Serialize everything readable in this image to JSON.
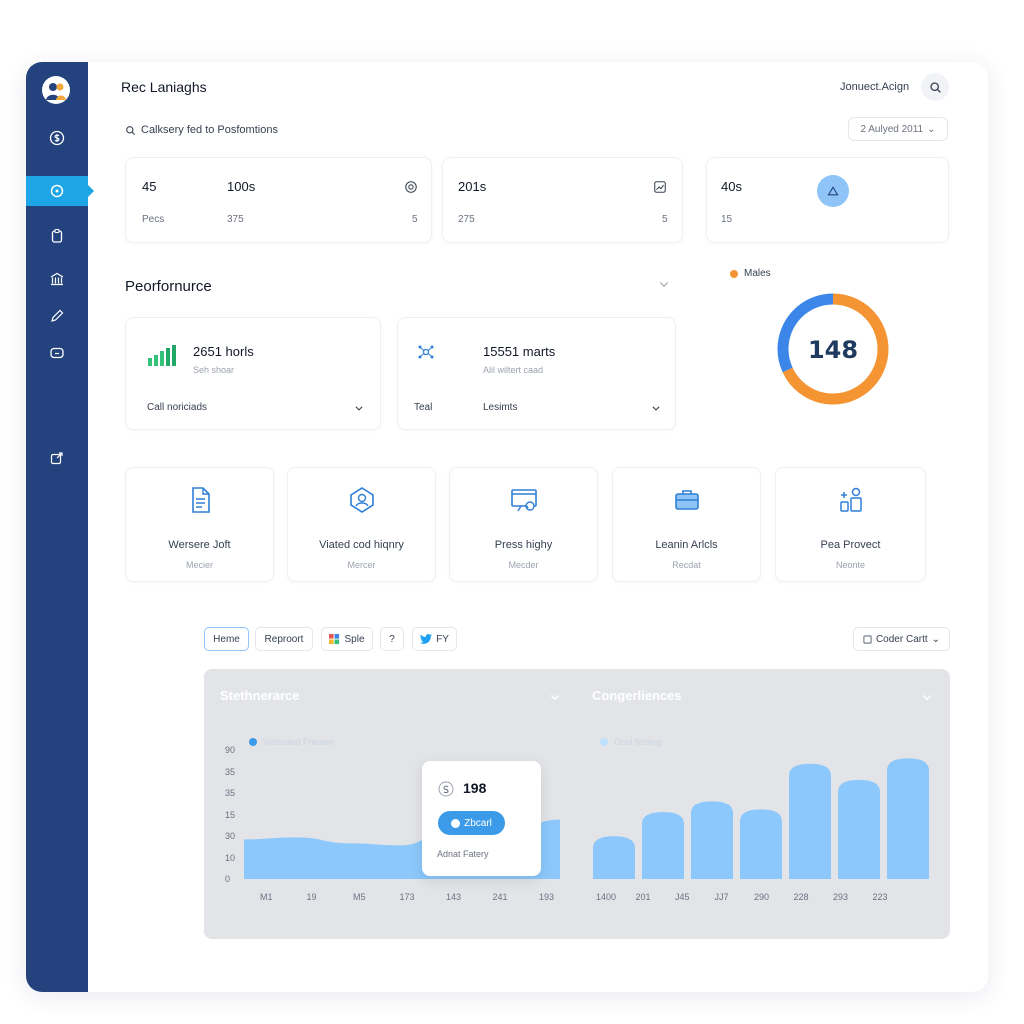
{
  "sidebar": {
    "avatar_icon": "users-icon",
    "items": [
      {
        "icon": "dollar-icon"
      },
      {
        "icon": "dashboard-icon",
        "active": true
      },
      {
        "icon": "clipboard-icon"
      },
      {
        "icon": "bank-icon"
      },
      {
        "icon": "edit-icon"
      },
      {
        "icon": "monitor-icon"
      },
      {
        "icon": "share-icon"
      }
    ]
  },
  "header": {
    "title": "Rec Laniaghs",
    "user_link": "Jonuect.Acign",
    "search_text": "Calksery fed to Posfomtions",
    "date_select": "2 Aulyed 2011"
  },
  "stats": [
    {
      "value_a": "45",
      "value_b": "100s",
      "sub_a": "Pecs",
      "sub_b": "375",
      "sub_c": "5",
      "icon": "badge-icon"
    },
    {
      "value_a": "201s",
      "sub_a": "275",
      "sub_c": "5",
      "icon": "image-icon"
    },
    {
      "value_a": "40s",
      "sub_a": "15",
      "icon": "triangle-icon"
    }
  ],
  "performance": {
    "title": "Peorfornurce",
    "metrics": [
      {
        "value": "2651 horls",
        "sub": "Seh shoar",
        "footer_left": "Call noriciads",
        "footer_right": "",
        "icon": "signal-bars-icon"
      },
      {
        "value": "15551 marts",
        "sub": "Alil wiltert caad",
        "footer_left": "Teal",
        "footer_right": "Lesimts",
        "icon": "network-icon"
      }
    ]
  },
  "donut": {
    "legend": "Males",
    "value": "148",
    "share_blue": 0.32,
    "share_orange": 0.68,
    "colors": {
      "blue": "#3b86e8",
      "orange": "#f59433"
    }
  },
  "tiles": [
    {
      "title": "Wersere Joft",
      "sub": "Mecier",
      "icon": "document-icon"
    },
    {
      "title": "Viated cod hiqnry",
      "sub": "Mercer",
      "icon": "network-icon"
    },
    {
      "title": "Press highy",
      "sub": "Mecder",
      "icon": "presentation-icon"
    },
    {
      "title": "Leanin Arlcls",
      "sub": "Recdat",
      "icon": "briefcase-icon"
    },
    {
      "title": "Pea Provect",
      "sub": "Neonte",
      "icon": "people-icon"
    }
  ],
  "tabs": [
    {
      "label": "Heme",
      "active": true
    },
    {
      "label": "Reproort"
    },
    {
      "label": "Sple",
      "icon": "apps-icon"
    },
    {
      "label": "?"
    },
    {
      "label": "FY",
      "icon": "twitter-icon"
    }
  ],
  "code_select": "Coder Cartt",
  "chart_data": [
    {
      "type": "area",
      "title": "Stethnerarce",
      "legend": "Vistoated Fremen",
      "y_ticks": [
        "0",
        "10",
        "30",
        "15",
        "35",
        "35",
        "90"
      ],
      "categories": [
        "M1",
        "19",
        "M5",
        "173",
        "143",
        "241",
        "193"
      ],
      "values": [
        20,
        21,
        18,
        17,
        27,
        24,
        30
      ],
      "ylim": [
        0,
        100
      ],
      "color": "#8cc8fb",
      "tooltip": {
        "value": "198",
        "button": "Zbcarl",
        "footer": "Adnat Fatery"
      }
    },
    {
      "type": "bar",
      "title": "Congerliences",
      "legend": "Ocol fecling",
      "categories": [
        "1400",
        "201",
        "J45",
        "JJ7",
        "290",
        "228",
        "293",
        "223"
      ],
      "values": [
        32,
        50,
        58,
        52,
        86,
        74,
        90
      ],
      "ylim": [
        0,
        100
      ],
      "color": "#8cc8fb"
    }
  ]
}
